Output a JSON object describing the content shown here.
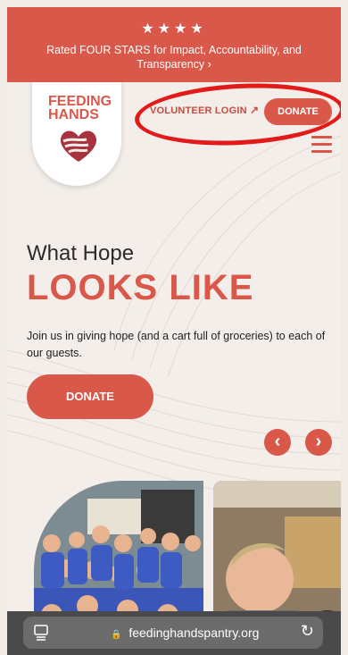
{
  "banner": {
    "stars": "★★★★",
    "text": "Rated FOUR STARS for Impact, Accountability, and Transparency ›"
  },
  "logo": {
    "line1": "FEEDING",
    "line2": "HANDS"
  },
  "nav": {
    "volunteer_login": "VOLUNTEER LOGIN",
    "volunteer_arrow": "↗",
    "donate": "DONATE"
  },
  "hero": {
    "title_small": "What Hope",
    "title_big": "LOOKS LIKE",
    "description": "Join us in giving hope (and a cart full of groceries) to each of our guests.",
    "donate_button": "DONATE",
    "prev_arrow": "‹",
    "next_arrow": "›"
  },
  "browser": {
    "url": "feedinghandspantry.org",
    "lock_icon": "🔒",
    "reload_icon": "↻"
  },
  "colors": {
    "brand_red": "#d9584a",
    "background": "#f3eee9",
    "annotation_red": "#e21a1a"
  }
}
